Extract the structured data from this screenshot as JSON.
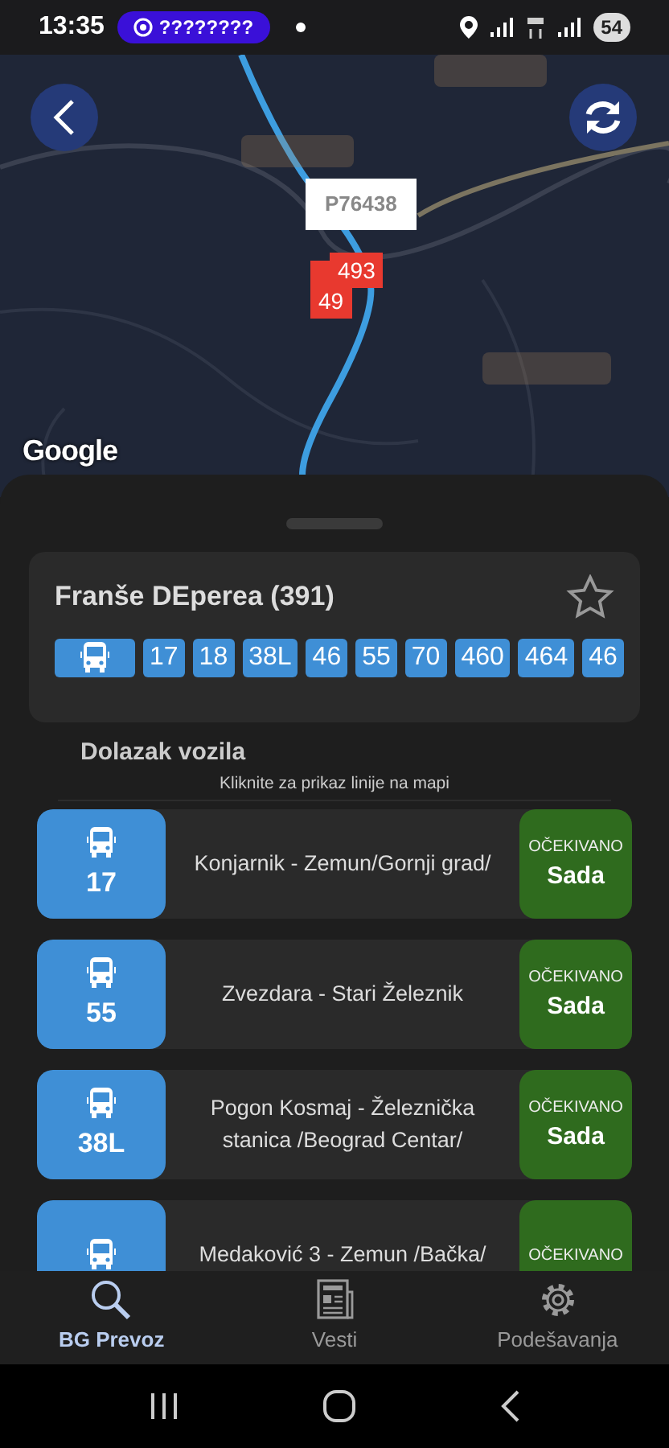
{
  "status_bar": {
    "time": "13:35",
    "notification": "????????",
    "battery": "54"
  },
  "map": {
    "kind": "picture",
    "attribution": "Google",
    "callout": "P76438",
    "markers": [
      {
        "label": "49"
      },
      {
        "label": "493"
      }
    ]
  },
  "stop": {
    "title": "Franše DEperea (391)",
    "favorite": false,
    "lines": [
      "17",
      "18",
      "38L",
      "46",
      "55",
      "70",
      "460",
      "464",
      "46"
    ]
  },
  "arrivals": {
    "title": "Dolazak vozila",
    "hint": "Kliknite za prikaz linije na mapi",
    "items": [
      {
        "line": "17",
        "route": "Konjarnik - Zemun/Gornji grad/",
        "status": "OČEKIVANO",
        "eta": "Sada"
      },
      {
        "line": "55",
        "route": "Zvezdara - Stari Železnik",
        "status": "OČEKIVANO",
        "eta": "Sada"
      },
      {
        "line": "38L",
        "route": "Pogon Kosmaj - Železnička stanica /Beograd Centar/",
        "status": "OČEKIVANO",
        "eta": "Sada"
      },
      {
        "route": "Medaković 3 - Zemun /Bačka/",
        "status": "OČEKIVANO"
      }
    ]
  },
  "bottom_nav": [
    {
      "label": "BG Prevoz",
      "selected": true
    },
    {
      "label": "Vesti",
      "selected": false
    },
    {
      "label": "Podešavanja",
      "selected": false
    }
  ]
}
